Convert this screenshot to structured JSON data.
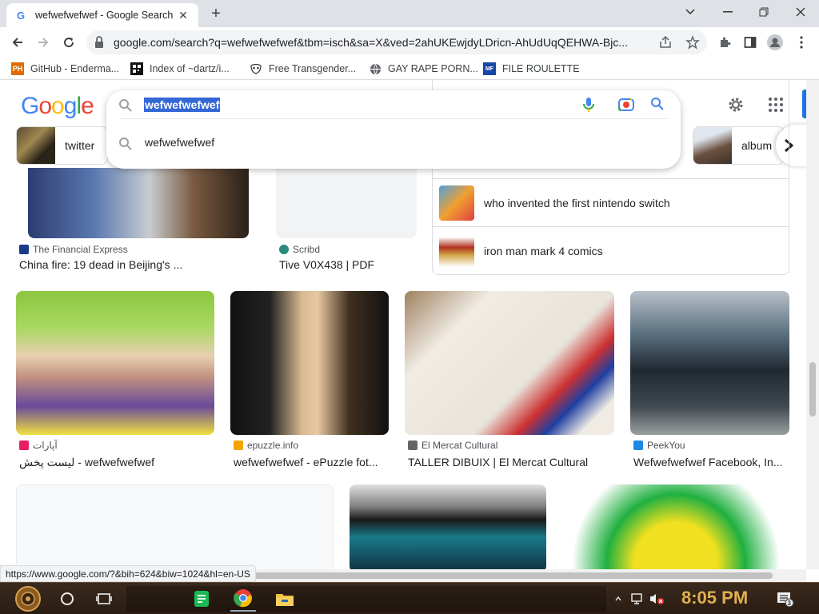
{
  "browser": {
    "tab_title": "wefwefwefwef - Google Search",
    "url": "google.com/search?q=wefwefwefwef&tbm=isch&sa=X&ved=2ahUKEwjdyLDricn-AhUdUqQEHWA-Bjc...",
    "bookmarks": [
      {
        "label": "GitHub - Enderma...",
        "icon": "ph-icon"
      },
      {
        "label": "Index of ~dartz/i...",
        "icon": "qr-icon"
      },
      {
        "label": "Free Transgender...",
        "icon": "mask-icon"
      },
      {
        "label": "GAY RAPE PORN...",
        "icon": "globe-icon"
      },
      {
        "label": "FILE ROULETTE",
        "icon": "mf-icon"
      }
    ],
    "status_url": "https://www.google.com/?&bih=624&biw=1024&hl=en-US"
  },
  "google": {
    "logo": [
      "G",
      "o",
      "o",
      "g",
      "l",
      "e"
    ],
    "query": "wefwefwefwef",
    "suggestion": "wefwefwefwef",
    "chips": [
      {
        "label": "twitter"
      },
      {
        "label": "album"
      }
    ]
  },
  "results_top": [
    {
      "source": "The Financial Express",
      "caption": "China fire: 19 dead in Beijing's ..."
    },
    {
      "source": "Scribd",
      "caption": "Tive V0X438 | PDF"
    }
  ],
  "related": [
    {
      "text": "who invented the first nintendo switch"
    },
    {
      "text": "iron man mark 4 comics"
    }
  ],
  "results_mid": [
    {
      "source": "آپارات",
      "caption": "لیست پخش - wefwefwefwef",
      "source_color": "#e91e63"
    },
    {
      "source": "epuzzle.info",
      "caption": "wefwefwefwef - ePuzzle fot...",
      "source_color": "#f4a300"
    },
    {
      "source": "El Mercat Cultural",
      "caption": "TALLER DIBUIX | El Mercat Cultural",
      "source_color": "#555555"
    },
    {
      "source": "PeekYou",
      "caption": "Wefwefwefwef Facebook, In...",
      "source_color": "#1e88e5"
    }
  ],
  "taskbar": {
    "clock": "8:05 PM",
    "notif_count": "3"
  },
  "colors": {
    "accent": "#1a73e8",
    "highlight": "#3367d6"
  }
}
